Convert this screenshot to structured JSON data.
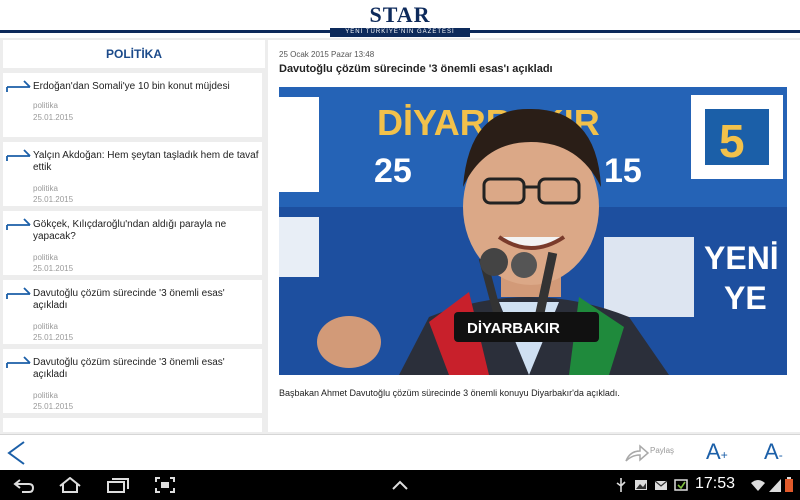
{
  "header": {
    "logo": "STAR",
    "tagline": "YENİ TÜRKİYE'NİN GAZETESİ"
  },
  "sidebar": {
    "section_title": "POLİTİKA",
    "items": [
      {
        "title": "Erdoğan'dan Somali'ye 10 bin konut müjdesi",
        "category": "politika",
        "date": "25.01.2015"
      },
      {
        "title": "Yalçın Akdoğan: Hem şeytan taşladık hem de tavaf ettik",
        "category": "politika",
        "date": "25.01.2015"
      },
      {
        "title": "Gökçek, Kılıçdaroğlu'ndan aldığı parayla ne yapacak?",
        "category": "politika",
        "date": "25.01.2015"
      },
      {
        "title": "Davutoğlu çözüm sürecinde '3 önemli esas' açıkladı",
        "category": "politika",
        "date": "25.01.2015"
      },
      {
        "title": "Davutoğlu çözüm sürecinde '3 önemli esas' açıkladı",
        "category": "politika",
        "date": "25.01.2015"
      }
    ]
  },
  "article": {
    "meta": "25 Ocak 2015 Pazar  13:48",
    "headline": "Davutoğlu çözüm sürecinde '3 önemli esas'ı açıkladı",
    "caption": "Başbakan Ahmet Davutoğlu çözüm sürecinde 3 önemli konuyu Diyarbakır'da açıkladı.",
    "photo": {
      "backdrop_text": "DİYARBAKIR",
      "backdrop_number": "25",
      "backdrop_number2": "15",
      "backdrop_right": "YENİ",
      "backdrop_right2": "YE",
      "podium_label": "DİYARBAKIR",
      "banner_number": "5"
    }
  },
  "toolbar": {
    "share_label": "Paylaş",
    "font_increase": "A",
    "font_increase_sign": "+",
    "font_decrease": "A",
    "font_decrease_sign": "-"
  },
  "system_bar": {
    "time": "17:53"
  },
  "colors": {
    "brand": "#0d2a5b",
    "accent": "#1b5fa8",
    "photo_blue": "#1d4f9f"
  },
  "icons": [
    "back-icon",
    "home-icon",
    "recent-apps-icon",
    "screenshot-icon",
    "chevron-up-icon",
    "usb-icon",
    "gallery-icon",
    "mail-icon",
    "sync-icon",
    "wifi-icon",
    "signal-icon",
    "battery-icon",
    "share-icon",
    "arrow-icon"
  ]
}
